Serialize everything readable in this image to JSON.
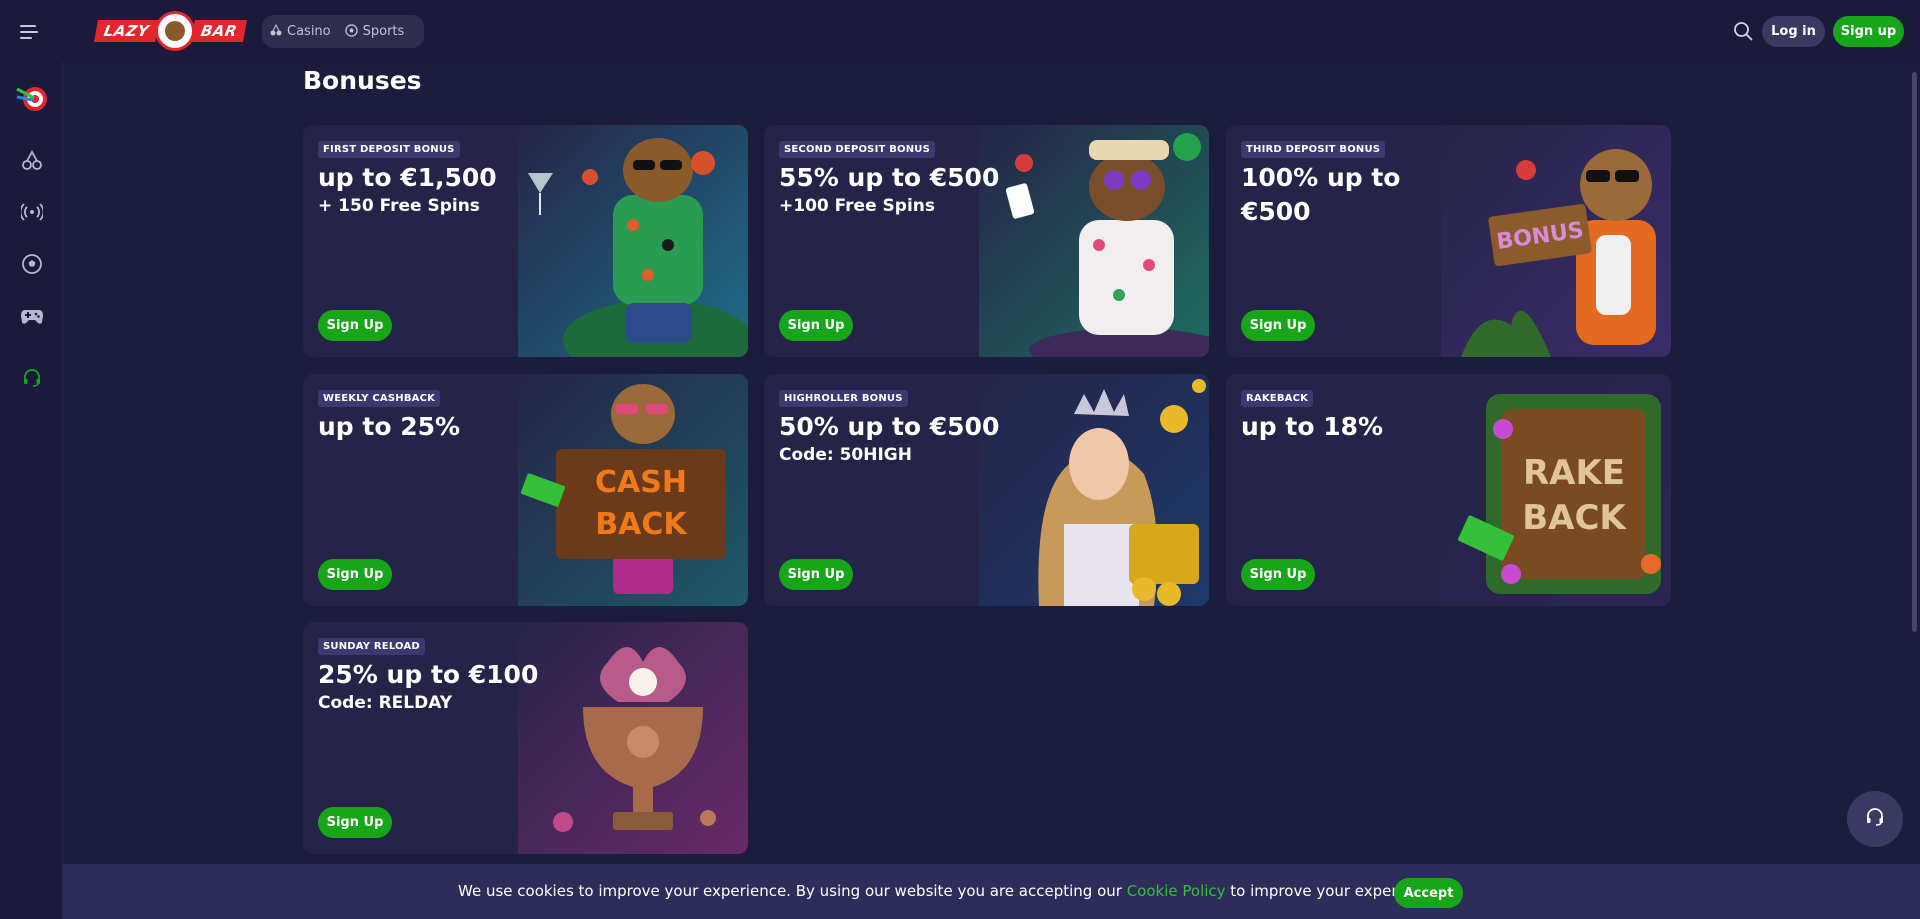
{
  "header": {
    "menu_icon": "hamburger-icon",
    "logo_text_left": "LAZY",
    "logo_text_right": "BAR",
    "nav": [
      {
        "label": "Casino",
        "icon": "cherry-icon"
      },
      {
        "label": "Sports",
        "icon": "soccer-ball-icon"
      }
    ],
    "search_icon": "search-icon",
    "login_label": "Log in",
    "signup_label": "Sign up"
  },
  "sidebar": {
    "items": [
      {
        "icon": "darts-target-icon"
      },
      {
        "icon": "cherry-icon"
      },
      {
        "icon": "live-broadcast-icon"
      },
      {
        "icon": "soccer-ball-icon"
      },
      {
        "icon": "gamepad-icon"
      },
      {
        "icon": "support-headset-icon"
      }
    ]
  },
  "main": {
    "title": "Bonuses",
    "cards": [
      {
        "tag": "FIRST DEPOSIT BONUS",
        "headline": "up to €1,500",
        "sub": "+ 150 Free Spins",
        "cta": "Sign Up",
        "art": "capybara-cocktail-art",
        "bg": "#1f6e8a"
      },
      {
        "tag": "SECOND DEPOSIT BONUS",
        "headline": "55% up to €500",
        "sub": "+100 Free Spins",
        "cta": "Sign Up",
        "art": "poker-bear-art",
        "bg": "#1e6d60"
      },
      {
        "tag": "THIRD DEPOSIT BONUS",
        "headline": "100% up to €500",
        "sub": "",
        "cta": "Sign Up",
        "art": "capybara-bonus-sign-art",
        "bg": "#3a2d6a",
        "sign": "BONUS"
      },
      {
        "tag": "WEEKLY CASHBACK",
        "headline": "up to 25%",
        "sub": "",
        "cta": "Sign Up",
        "art": "cashback-sign-art",
        "bg": "#1e5a66",
        "sign": "CASH BACK"
      },
      {
        "tag": "HIGHROLLER BONUS",
        "headline": "50% up to €500",
        "sub": "Code: 50HIGH",
        "cta": "Sign Up",
        "art": "queen-gold-art",
        "bg": "#1c3a6a"
      },
      {
        "tag": "RAKEBACK",
        "headline": "up to 18%",
        "sub": "",
        "cta": "Sign Up",
        "art": "rakeback-sign-art",
        "bg": "#2b2452",
        "sign": "RAKE BACK"
      },
      {
        "tag": "SUNDAY RELOAD",
        "headline": "25% up to €100",
        "sub": "Code: RELDAY",
        "cta": "Sign Up",
        "art": "trophy-flower-art",
        "bg": "#6a2a6a"
      }
    ]
  },
  "chat": {
    "icon": "headset-icon"
  },
  "cookie": {
    "text_before": "We use cookies to improve your experience. By using our website you are accepting our ",
    "link": "Cookie Policy",
    "text_after": " to improve your experience",
    "accept": "Accept"
  },
  "colors": {
    "background": "#1c1c3c",
    "card": "#252448",
    "accent_green": "#17a619",
    "tag_bg": "#3b3970"
  }
}
